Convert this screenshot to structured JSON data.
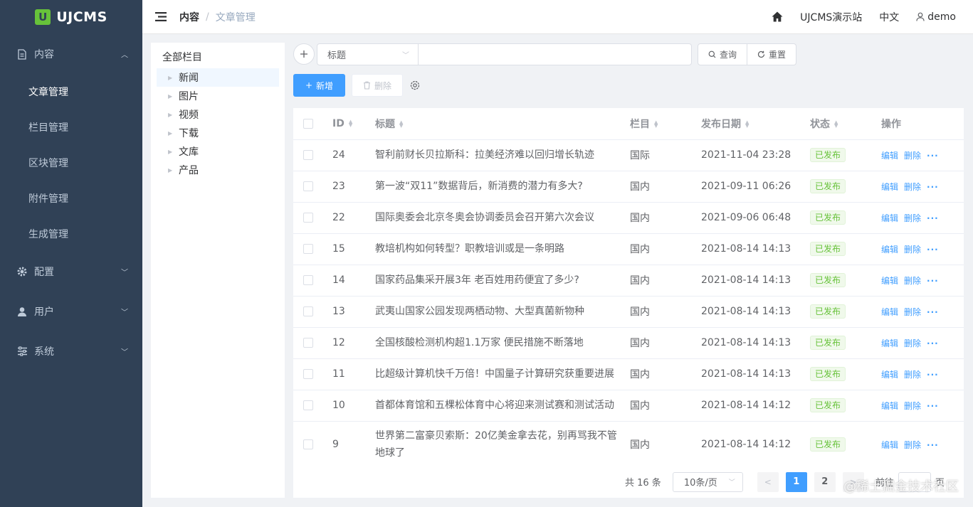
{
  "brand": {
    "logo_mark": "U",
    "name": "UJCMS"
  },
  "sidebar": {
    "groups": [
      {
        "label": "内容",
        "icon": "document-icon",
        "expanded": true,
        "items": [
          "文章管理",
          "栏目管理",
          "区块管理",
          "附件管理",
          "生成管理"
        ]
      },
      {
        "label": "配置",
        "icon": "gear-icon"
      },
      {
        "label": "用户",
        "icon": "user-icon"
      },
      {
        "label": "系统",
        "icon": "sliders-icon"
      }
    ],
    "active_item": "文章管理"
  },
  "header": {
    "breadcrumb": [
      "内容",
      "文章管理"
    ],
    "site": "UJCMS演示站",
    "lang": "中文",
    "user": "demo"
  },
  "tree": {
    "root": "全部栏目",
    "nodes": [
      "新闻",
      "图片",
      "视频",
      "下载",
      "文库",
      "产品"
    ],
    "selected": "新闻"
  },
  "search": {
    "field_select": "标题",
    "query_label": "查询",
    "reset_label": "重置"
  },
  "toolbar": {
    "add_label": "新增",
    "delete_label": "删除"
  },
  "table": {
    "columns": [
      "ID",
      "标题",
      "栏目",
      "发布日期",
      "状态",
      "操作"
    ],
    "rows": [
      {
        "id": "24",
        "title": "智利前财长贝拉斯科：拉美经济难以回归增长轨迹",
        "channel": "国际",
        "date": "2021-11-04 23:28",
        "status": "已发布"
      },
      {
        "id": "23",
        "title": "第一波“双11”数据背后，新消费的潜力有多大?",
        "channel": "国内",
        "date": "2021-09-11 06:26",
        "status": "已发布"
      },
      {
        "id": "22",
        "title": "国际奥委会北京冬奥会协调委员会召开第六次会议",
        "channel": "国内",
        "date": "2021-09-06 06:48",
        "status": "已发布"
      },
      {
        "id": "15",
        "title": "教培机构如何转型？职教培训或是一条明路",
        "channel": "国内",
        "date": "2021-08-14 14:13",
        "status": "已发布"
      },
      {
        "id": "14",
        "title": "国家药品集采开展3年 老百姓用药便宜了多少?",
        "channel": "国内",
        "date": "2021-08-14 14:13",
        "status": "已发布"
      },
      {
        "id": "13",
        "title": "武夷山国家公园发现两栖动物、大型真菌新物种",
        "channel": "国内",
        "date": "2021-08-14 14:13",
        "status": "已发布"
      },
      {
        "id": "12",
        "title": "全国核酸检测机构超1.1万家 便民措施不断落地",
        "channel": "国内",
        "date": "2021-08-14 14:13",
        "status": "已发布"
      },
      {
        "id": "11",
        "title": "比超级计算机快千万倍！中国量子计算研究获重要进展",
        "channel": "国内",
        "date": "2021-08-14 14:13",
        "status": "已发布"
      },
      {
        "id": "10",
        "title": "首都体育馆和五棵松体育中心将迎来测试赛和测试活动",
        "channel": "国内",
        "date": "2021-08-14 14:12",
        "status": "已发布"
      },
      {
        "id": "9",
        "title": "世界第二富豪贝索斯：20亿美金拿去花，别再骂我不管地球了",
        "channel": "国内",
        "date": "2021-08-14 14:12",
        "status": "已发布"
      }
    ],
    "op_edit": "编辑",
    "op_delete": "删除",
    "op_more": "···"
  },
  "pagination": {
    "total_text": "共 16 条",
    "page_size": "10条/页",
    "pages": [
      "1",
      "2"
    ],
    "current": "1",
    "goto_label": "前往",
    "page_suffix": "页"
  },
  "watermark": "@稀土掘金技术社区",
  "colors": {
    "sidebar_bg": "#304156",
    "primary": "#409eff",
    "success": "#67c23a"
  }
}
